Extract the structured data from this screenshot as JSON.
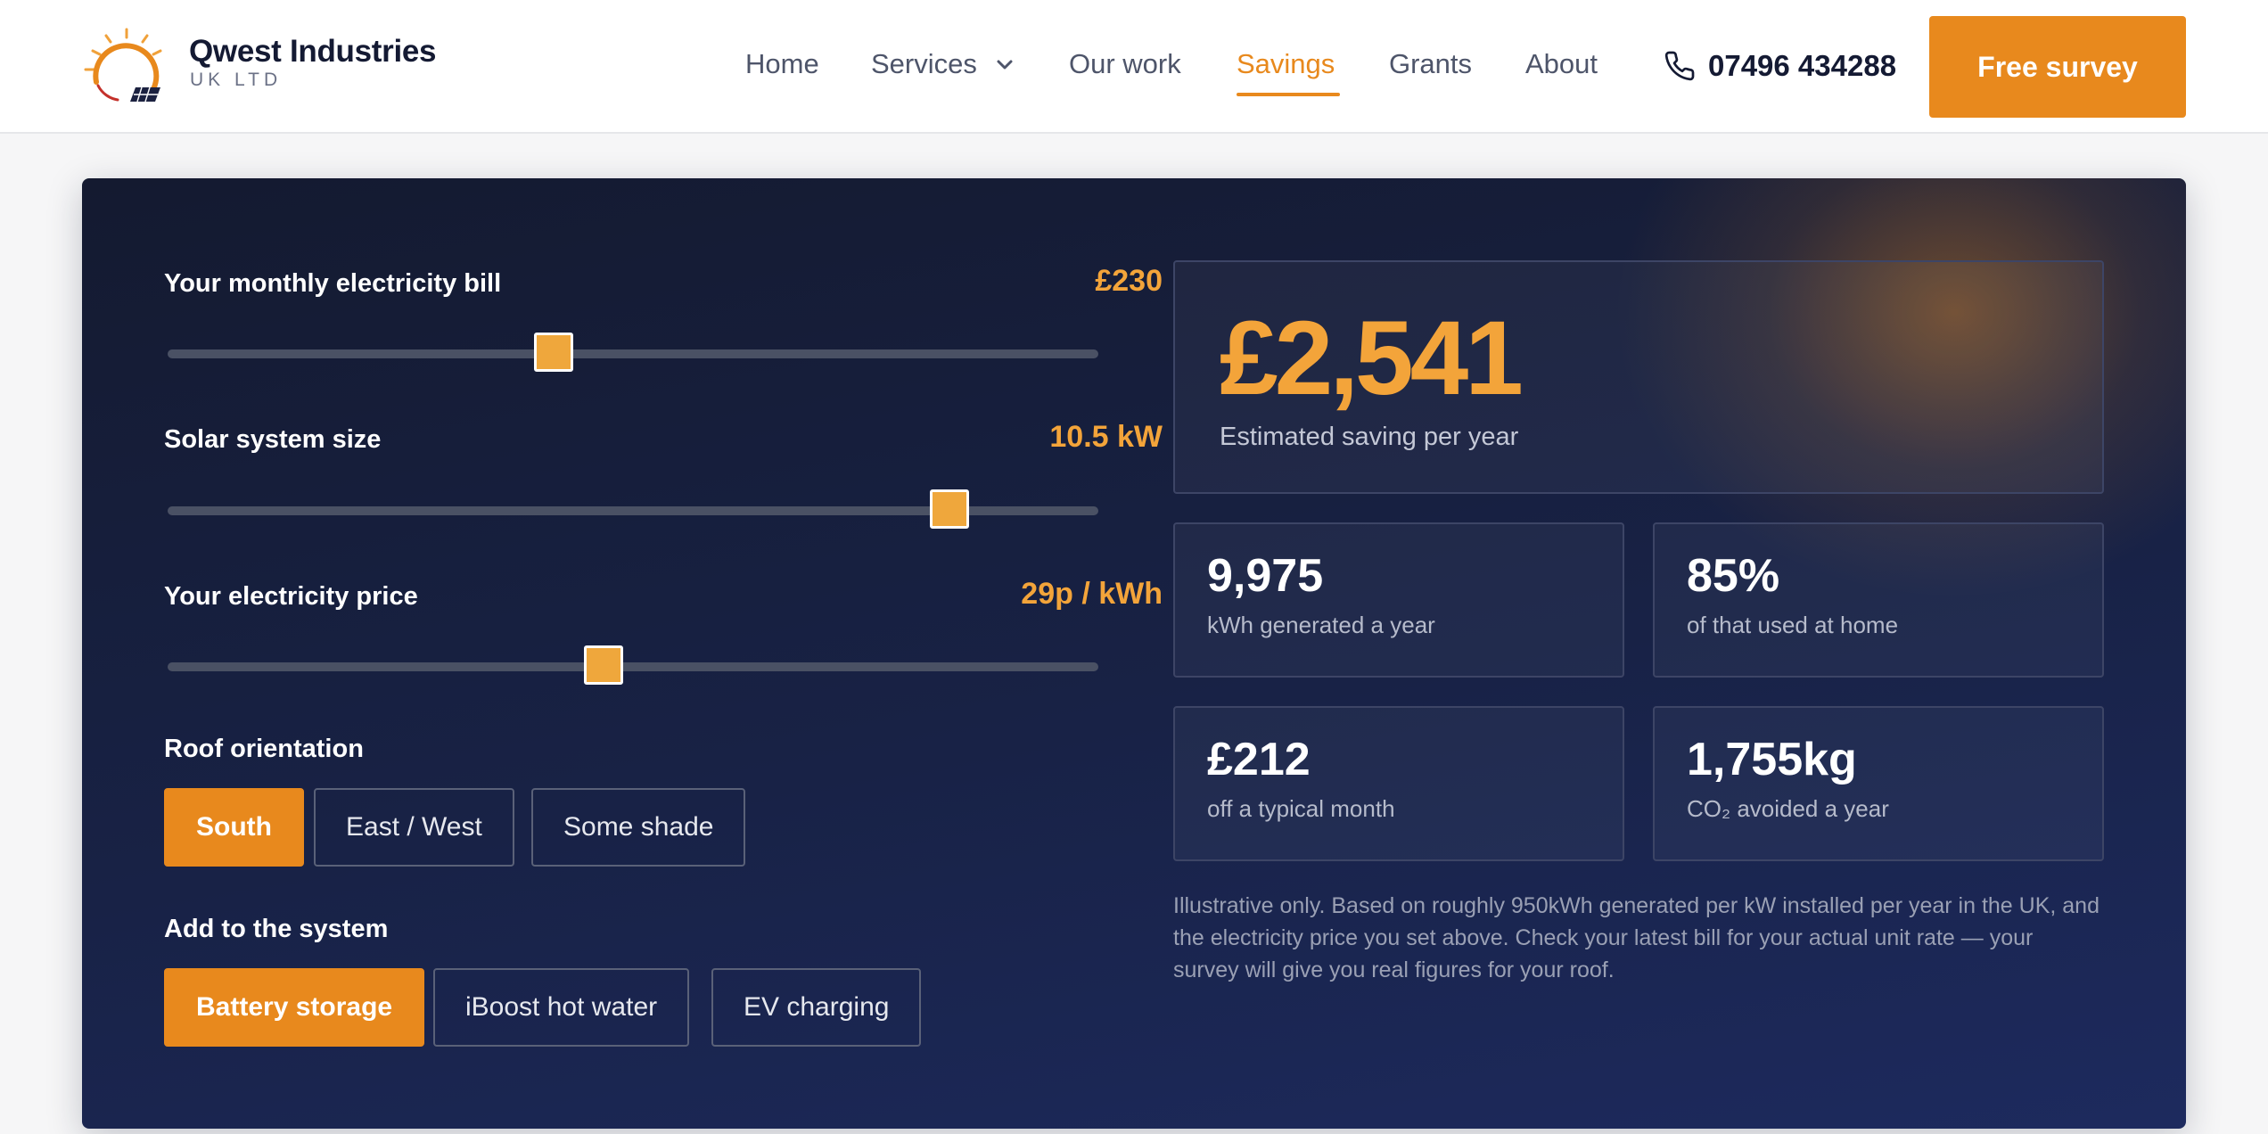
{
  "brand": {
    "name": "Qwest Industries",
    "subtitle": "UK LTD"
  },
  "nav": {
    "items": [
      {
        "label": "Home"
      },
      {
        "label": "Services"
      },
      {
        "label": "Our work"
      },
      {
        "label": "Savings"
      },
      {
        "label": "Grants"
      },
      {
        "label": "About"
      }
    ],
    "active": "Savings"
  },
  "contact": {
    "phone": "07496 434288",
    "phone_icon": "phone-icon"
  },
  "cta": {
    "label": "Free survey"
  },
  "calculator": {
    "sliders": [
      {
        "label": "Your monthly electricity bill",
        "value": "£230",
        "fraction": 0.415
      },
      {
        "label": "Solar system size",
        "value": "10.5 kW",
        "fraction": 0.84
      },
      {
        "label": "Your electricity price",
        "value": "29p / kWh",
        "fraction": 0.468
      }
    ],
    "roof": {
      "label": "Roof orientation",
      "options": [
        {
          "label": "South",
          "selected": true
        },
        {
          "label": "East / West",
          "selected": false
        },
        {
          "label": "Some shade",
          "selected": false
        }
      ]
    },
    "extras": {
      "label": "Add to the system",
      "options": [
        {
          "label": "Battery storage",
          "selected": true
        },
        {
          "label": "iBoost hot water",
          "selected": false
        },
        {
          "label": "EV charging",
          "selected": false
        }
      ]
    }
  },
  "results": {
    "saving": {
      "value": "£2,541",
      "caption": "Estimated saving per year"
    },
    "stats": [
      {
        "value": "9,975",
        "caption": "kWh generated a year"
      },
      {
        "value": "85%",
        "caption": "of that used at home"
      },
      {
        "value": "£212",
        "caption": "off a typical month"
      },
      {
        "value": "1,755kg",
        "caption": "CO₂ avoided a year"
      }
    ],
    "disclaimer": "Illustrative only. Based on roughly 950kWh generated per kW installed per year in the UK, and the electricity price you set above. Check your latest bill for your actual unit rate — your survey will give you real figures for your roof."
  },
  "colors": {
    "accent": "#e8891d",
    "accent_light": "#f3a43a",
    "panel": "#182246"
  }
}
